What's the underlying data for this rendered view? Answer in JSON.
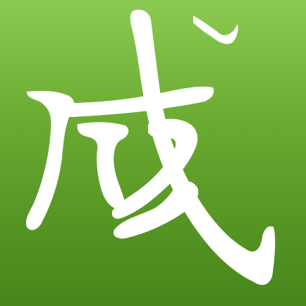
{
  "app_icon": {
    "character": "成",
    "colors": {
      "background_top": "#8ccb52",
      "background_bottom": "#47851a",
      "glyph": "#ffffff"
    }
  }
}
